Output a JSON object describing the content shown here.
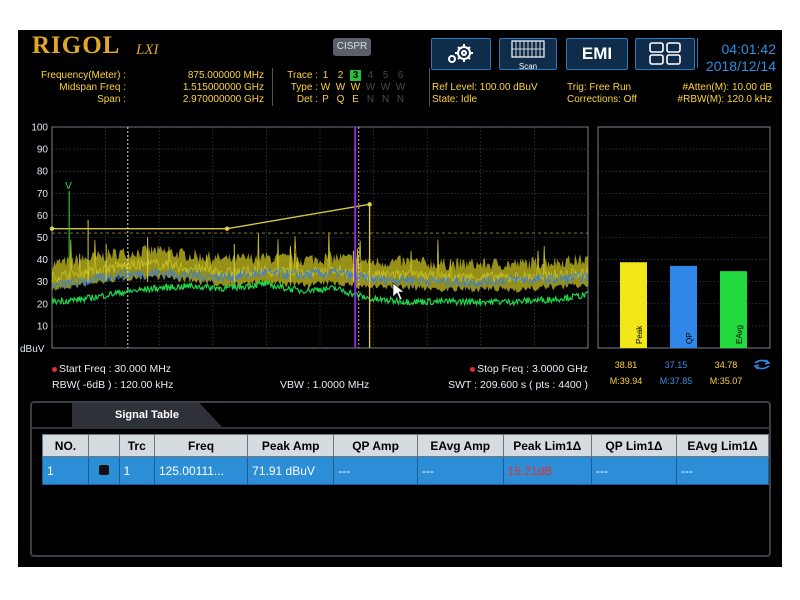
{
  "header": {
    "brand": "RIGOL",
    "lxi": "LXI",
    "cispr_label": "CISPR",
    "freq_rows": [
      {
        "label": "Frequency(Meter) :",
        "value": "875.000000 MHz"
      },
      {
        "label": "Midspan Freq :",
        "value": "1.515000000 GHz"
      },
      {
        "label": "Span :",
        "value": "2.970000000 GHz"
      }
    ],
    "trace": {
      "label": "Trace :",
      "nums": [
        "1",
        "2",
        "3",
        "4",
        "5",
        "6"
      ],
      "active": "3",
      "type_label": "Type :",
      "types": [
        "W",
        "W",
        "W",
        "W",
        "W",
        "W"
      ],
      "det_label": "Det :",
      "dets": [
        "P",
        "Q",
        "E",
        "N",
        "N",
        "N"
      ]
    },
    "ref_level": "Ref Level: 100.00 dBuV",
    "state": "State: Idle",
    "trig": "Trig: Free Run",
    "corrections": "Corrections: Off",
    "atten": "#Atten(M): 10.00 dB",
    "rbw_m": "#RBW(M): 120.0 kHz",
    "scan_label": "Scan",
    "emi_label": "EMI",
    "time": "04:01:42",
    "date": "2018/12/14"
  },
  "plot": {
    "unit_label": "dBuV",
    "start_freq": "Start Freq : 30.000 MHz",
    "stop_freq": "Stop Freq : 3.0000 GHz",
    "rbw": "RBW( -6dB ) : 120.00 kHz",
    "vbw": "VBW : 1.0000 MHz",
    "swt": "SWT : 209.600 s ( pts : 4400 )",
    "marker_label": "V"
  },
  "chart_data": {
    "type": "line",
    "ylabel": "dBuV",
    "ylim": [
      0,
      100
    ],
    "yticks": [
      10,
      20,
      30,
      40,
      50,
      60,
      70,
      80,
      90,
      100
    ],
    "xlim_mhz": [
      30,
      3000
    ],
    "grid": true,
    "limit_line": {
      "x_mhz": [
        30,
        1000,
        1000,
        1790,
        1790,
        1790
      ],
      "y": [
        54,
        54,
        54,
        65,
        65,
        0
      ]
    },
    "series": [
      {
        "color": "#c8c020",
        "x_mhz": [
          30,
          200,
          400,
          600,
          800,
          1000,
          1200,
          1400,
          1600,
          1800,
          2000,
          2200,
          2400,
          2600,
          2800,
          3000
        ],
        "y": [
          32,
          34,
          37,
          38,
          36,
          34,
          35,
          34,
          35,
          33,
          33,
          32,
          32,
          32,
          33,
          34
        ]
      },
      {
        "color": "#3b7fd8",
        "x_mhz": [
          30,
          200,
          400,
          600,
          800,
          1000,
          1200,
          1400,
          1600,
          1800,
          2000,
          2200,
          2400,
          2600,
          2800,
          3000
        ],
        "y": [
          28,
          30,
          33,
          34,
          33,
          32,
          34,
          33,
          34,
          31,
          31,
          30,
          30,
          31,
          31,
          32
        ]
      },
      {
        "color": "#1fd54a",
        "x_mhz": [
          30,
          200,
          400,
          600,
          800,
          1000,
          1200,
          1400,
          1600,
          1800,
          2000,
          2200,
          2400,
          2600,
          2800,
          3000
        ],
        "y": [
          21,
          22,
          25,
          27,
          28,
          27,
          29,
          26,
          27,
          22,
          21,
          21,
          21,
          21,
          22,
          24
        ]
      }
    ]
  },
  "bars": [
    {
      "name": "Peak",
      "value": 38.81,
      "value_text": "38.81",
      "max_text": "M:39.94",
      "color": "#f1e617",
      "text_color": "#ffd23c"
    },
    {
      "name": "QP",
      "value": 37.15,
      "value_text": "37.15",
      "max_text": "M:37.85",
      "color": "#2f86e6",
      "text_color": "#3a8de6"
    },
    {
      "name": "EAvg",
      "value": 34.78,
      "value_text": "34.78",
      "max_text": "M:35.07",
      "color": "#22d940",
      "text_color": "#ffd23c"
    }
  ],
  "signal_table": {
    "tab": "Signal Table",
    "headers": [
      "NO.",
      "",
      "Trc",
      "Freq",
      "Peak Amp",
      "QP Amp",
      "EAvg Amp",
      "Peak Lim1Δ",
      "QP Lim1Δ",
      "EAvg Lim1Δ"
    ],
    "rows": [
      [
        "1",
        "",
        "1",
        "125.00111...",
        "71.91 dBuV",
        "---",
        "---",
        "16.21dB",
        "---",
        "---"
      ]
    ]
  }
}
